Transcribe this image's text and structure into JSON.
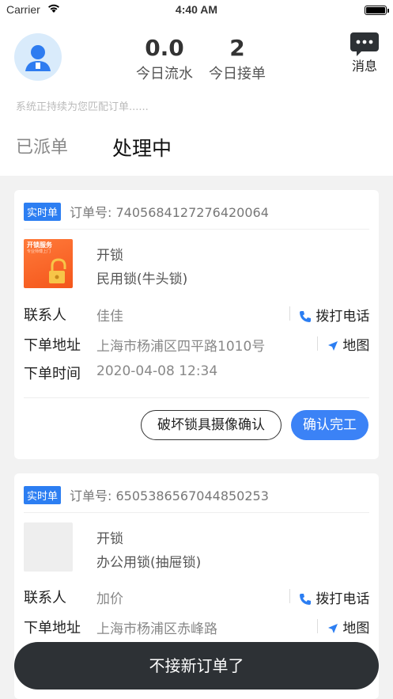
{
  "status_bar": {
    "carrier": "Carrier",
    "time": "4:40 AM"
  },
  "header": {
    "revenue_value": "0.0",
    "revenue_label": "今日流水",
    "orders_value": "2",
    "orders_label": "今日接单",
    "messages_label": "消息",
    "matching_text": "系统正持续为您匹配订单......"
  },
  "tabs": [
    {
      "label": "已派单",
      "active": false
    },
    {
      "label": "处理中",
      "active": true
    }
  ],
  "orders": [
    {
      "badge": "实时单",
      "order_no": "订单号: 7405684127276420064",
      "service": "开锁",
      "lock_type": "民用锁(牛头锁)",
      "thumb_title": "开锁服务",
      "thumb_sub": "专业师傅上门",
      "contact_label": "联系人",
      "contact_value": "佳佳",
      "call_label": "拨打电话",
      "address_label": "下单地址",
      "address_value": "上海市杨浦区四平路1010号",
      "map_label": "地图",
      "time_label": "下单时间",
      "time_value": "2020-04-08 12:34",
      "camera_btn": "破坏锁具摄像确认",
      "complete_btn": "确认完工"
    },
    {
      "badge": "实时单",
      "order_no": "订单号: 6505386567044850253",
      "service": "开锁",
      "lock_type": "办公用锁(抽屉锁)",
      "contact_label": "联系人",
      "contact_value": "加价",
      "call_label": "拨打电话",
      "address_label": "下单地址",
      "address_value": "上海市杨浦区赤峰路",
      "map_label": "地图"
    }
  ],
  "bottom_button": "不接新订单了",
  "colors": {
    "accent": "#3b82f6",
    "badge": "#2c7ef2",
    "bottom": "#2d3135"
  }
}
